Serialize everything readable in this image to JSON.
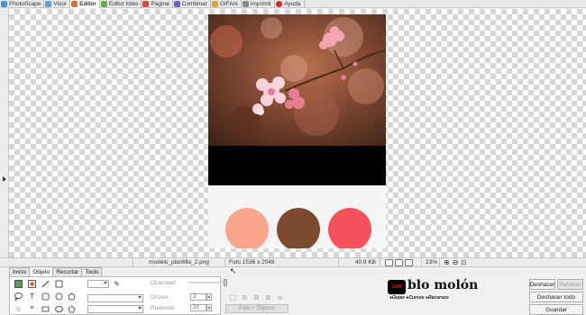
{
  "tabs": [
    {
      "label": "PhotoScape",
      "icon": "photoscape-icon",
      "color": "#3b9be0"
    },
    {
      "label": "Visor",
      "icon": "viewer-icon",
      "color": "#5aa1d8"
    },
    {
      "label": "Editor",
      "icon": "editor-icon",
      "color": "#e06c3b",
      "active": true
    },
    {
      "label": "Editor lotes",
      "icon": "batch-editor-icon",
      "color": "#6aa84f"
    },
    {
      "label": "Página",
      "icon": "page-icon",
      "color": "#e0463b"
    },
    {
      "label": "Combinar",
      "icon": "combine-icon",
      "color": "#7a5ccc"
    },
    {
      "label": "GIFAni",
      "icon": "gifani-icon",
      "color": "#e0a33b"
    },
    {
      "label": "Imprimir",
      "icon": "printer-icon",
      "color": "#888888"
    },
    {
      "label": "Ayuda",
      "icon": "help-icon",
      "color": "#d12a2a"
    }
  ],
  "palette": [
    "#f9a68b",
    "#7e4a2e",
    "#f4515c"
  ],
  "status": {
    "filename": "modelo_plantilla_2.png",
    "dimensions": "Foto 1536 x 2048",
    "filesize": "40.9 KB",
    "zoom": "23%"
  },
  "panel_tabs": [
    "Inicio",
    "Objeto",
    "Recortar",
    "Tools"
  ],
  "panel_active_tab": "Objeto",
  "labels": {
    "opacity": "Opacidad",
    "thickness": "Grosor",
    "rounded": "Redondo",
    "thickness_value": "2",
    "rounded_value": "23",
    "photo_objects": "Foto + Objetos"
  },
  "logo": {
    "mark": "ZAN",
    "name": "blo molón",
    "tagline": "●Guías ●Cursos ●Recursos"
  },
  "actions": {
    "undo": "Deshacer",
    "redo": "Rehacer",
    "undo_all": "Deshacer todo",
    "save": "Guardar"
  }
}
